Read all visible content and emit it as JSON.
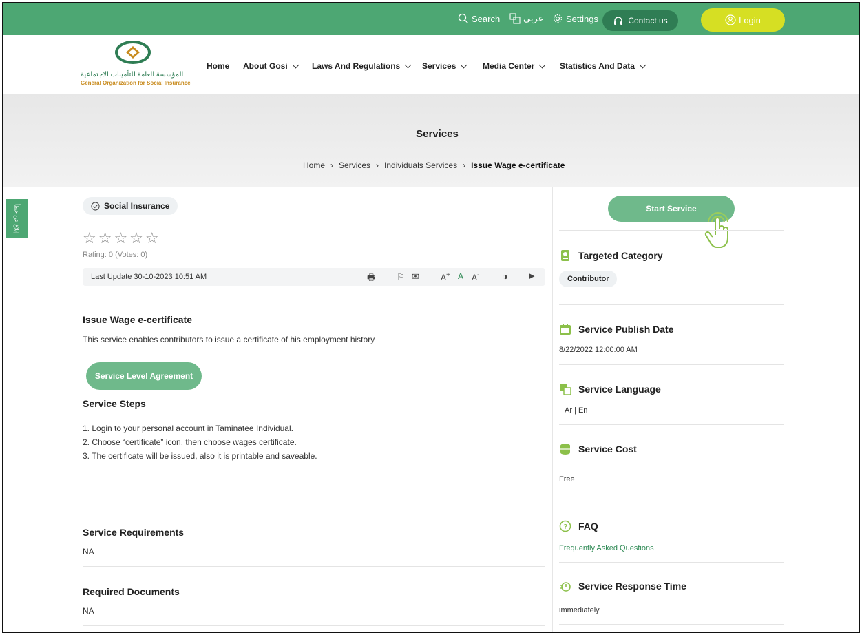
{
  "topbar": {
    "search": "Search",
    "language": "عربي",
    "settings": "Settings",
    "contact": "Contact us",
    "login": "Login"
  },
  "logo": {
    "arabic": "المؤسسة العامة للتأمينات الاجتماعية",
    "english": "General Organization for Social Insurance"
  },
  "nav": [
    "Home",
    "About Gosi",
    "Laws And Regulations",
    "Services",
    "Media Center",
    "Statistics And Data"
  ],
  "hero": {
    "title": "Services",
    "breadcrumb": [
      "Home",
      "Services",
      "Individuals Services",
      "Issue Wage e-certificate"
    ]
  },
  "side_tab": "إبلاغ عن خطأ",
  "main": {
    "tag": "Social Insurance",
    "stars": "☆☆☆☆☆",
    "rating": "Rating: 0 (Votes: 0)",
    "last_update": "Last Update 30-10-2023 10:51 AM",
    "service_title": "Issue Wage e-certificate",
    "service_desc": "This service enables contributors to issue a certificate of his employment history",
    "sla": "Service Level Agreement",
    "steps_title": "Service Steps",
    "steps": [
      "1. Login to your personal account in Taminatee Individual.",
      "2. Choose “certificate” icon, then choose wages certificate.",
      "3. The certificate will be issued, also it is printable and saveable."
    ],
    "requirements_title": "Service Requirements",
    "requirements": "NA",
    "documents_title": "Required Documents",
    "documents": "NA"
  },
  "side": {
    "start": "Start Service",
    "targeted_title": "Targeted Category",
    "targeted_value": "Contributor",
    "publish_title": "Service Publish Date",
    "publish_value": "8/22/2022 12:00:00 AM",
    "language_title": "Service Language",
    "language_value": "Ar  |  En",
    "cost_title": "Service Cost",
    "cost_value": "Free",
    "faq_title": "FAQ",
    "faq_value": "Frequently Asked Questions",
    "response_title": "Service Response Time",
    "response_value": "immediately"
  },
  "colors": {
    "brand_green": "#4da773",
    "button_green": "#6fb98b",
    "login_yellow": "#d6df23"
  }
}
